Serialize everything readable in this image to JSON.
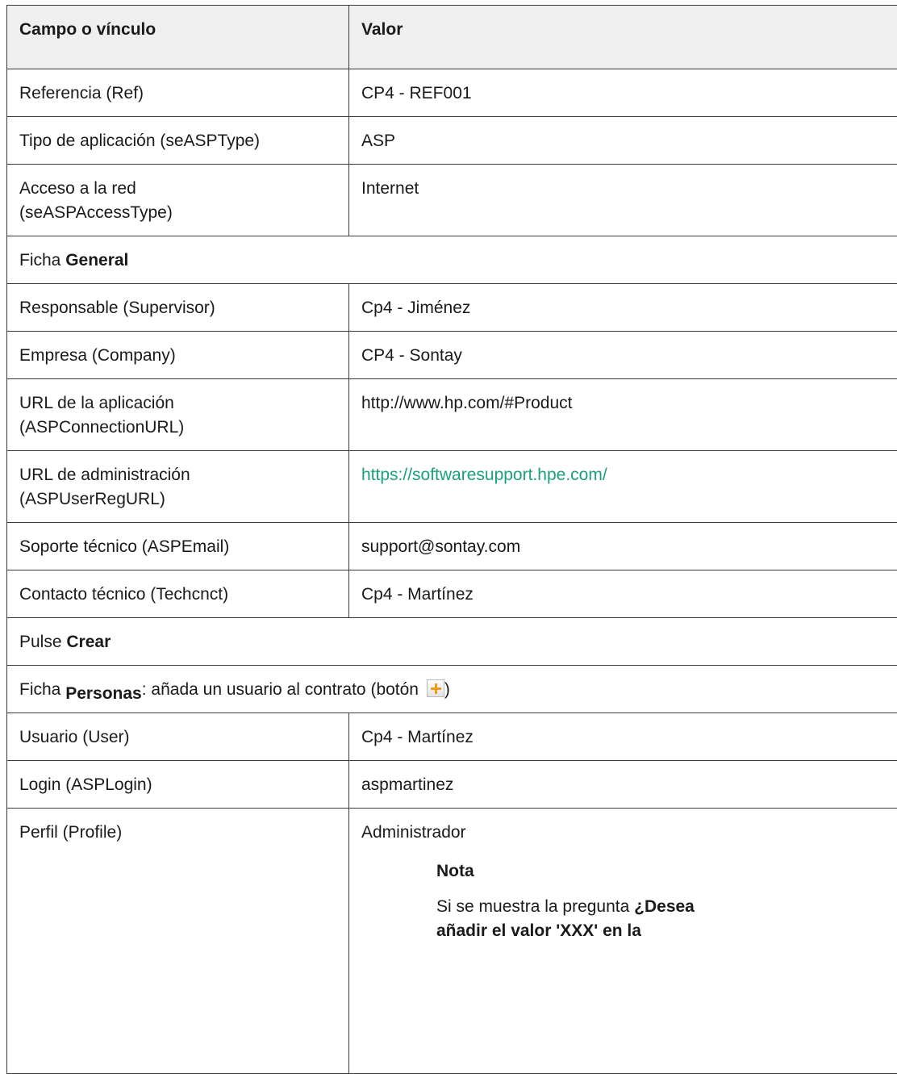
{
  "table": {
    "headers": [
      "Campo o vínculo",
      "Valor"
    ],
    "rows": [
      {
        "field": "Referencia (Ref)",
        "value": "CP4 - REF001"
      },
      {
        "field": "Tipo de aplicación (seASPType)",
        "value": "ASP"
      },
      {
        "field_line1": "Acceso a la red",
        "field_line2": "(seASPAccessType)",
        "value": "Internet"
      }
    ],
    "section_general": {
      "prefix": "Ficha ",
      "bold": "General"
    },
    "rows_general": [
      {
        "field": "Responsable (Supervisor)",
        "value": "Cp4 - Jiménez"
      },
      {
        "field": "Empresa (Company)",
        "value": "CP4 - Sontay"
      },
      {
        "field_line1": "URL de la aplicación",
        "field_line2": "(ASPConnectionURL)",
        "value": "http://www.hp.com/#Product"
      },
      {
        "field_line1": "URL de administración",
        "field_line2": "(ASPUserRegURL)",
        "value": "https://softwaresupport.hpe.com/"
      },
      {
        "field": "Soporte técnico (ASPEmail)",
        "value": "support@sontay.com"
      },
      {
        "field": "Contacto técnico (Techcnct)",
        "value": "Cp4 - Martínez"
      }
    ],
    "section_crear": {
      "prefix": "Pulse ",
      "bold": "Crear"
    },
    "section_personas": {
      "prefix": "Ficha ",
      "bold": "Personas",
      "suffix": ": añada un usuario al contrato (botón ",
      "close": ")"
    },
    "rows_personas": [
      {
        "field": "Usuario (User)",
        "value": "Cp4 - Martínez"
      },
      {
        "field": "Login (ASPLogin)",
        "value": "aspmartinez"
      },
      {
        "field": "Perfil (Profile)",
        "value": "Administrador"
      }
    ],
    "note": {
      "title": "Nota",
      "text_prefix": "Si se muestra la pregunta ",
      "bold_line1": "¿Desea",
      "bold_line2": "añadir el valor 'XXX' en la"
    }
  },
  "colors": {
    "link": "#1aa07c",
    "header_bg": "#efefef",
    "border": "#3a3a3a",
    "add_icon": "#f29a18"
  },
  "icons": {
    "add_button": "plus-icon"
  }
}
